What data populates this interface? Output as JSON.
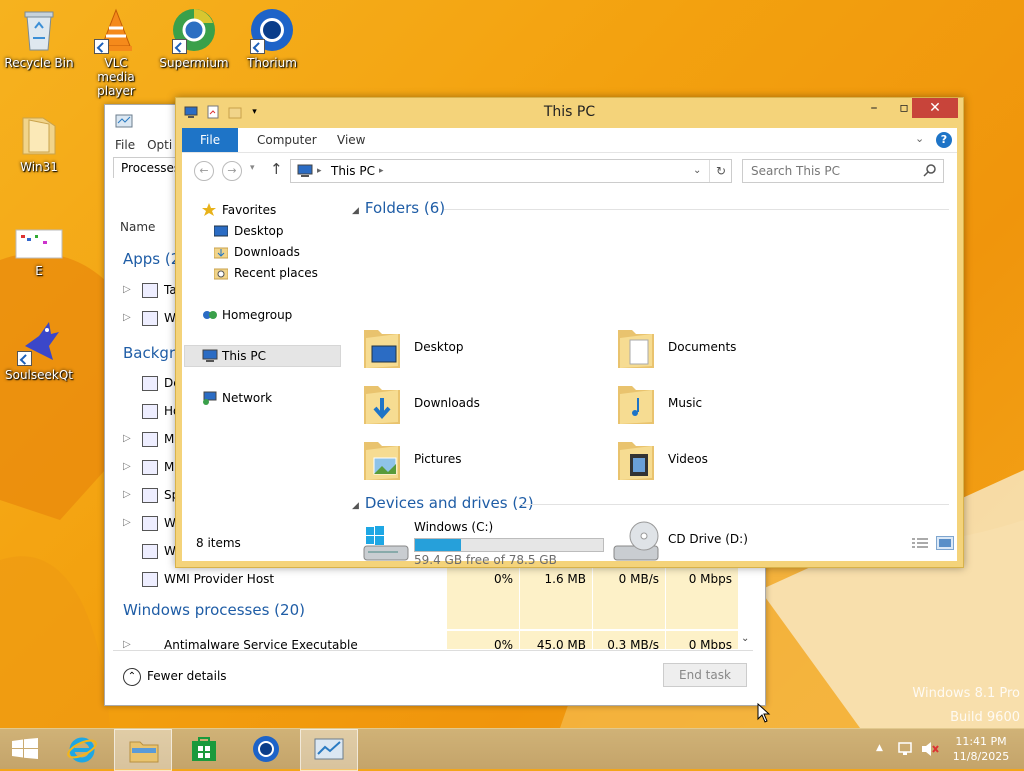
{
  "desktop": {
    "icons": [
      {
        "label": "Recycle Bin",
        "icon": "recycle-bin-icon"
      },
      {
        "label": "VLC media player",
        "icon": "vlc-icon"
      },
      {
        "label": "Supermium",
        "icon": "supermium-icon"
      },
      {
        "label": "Thorium",
        "icon": "thorium-icon"
      },
      {
        "label": "Win31",
        "icon": "folder-icon"
      },
      {
        "label": "E",
        "icon": "image-file-icon"
      },
      {
        "label": "SoulseekQt",
        "icon": "soulseek-icon"
      }
    ],
    "watermark": {
      "line1": "Windows 8.1 Pro",
      "line2": "Build 9600"
    }
  },
  "task_manager": {
    "menu": [
      "File",
      "Opti"
    ],
    "tab": "Processes",
    "column_name": "Name",
    "sections": {
      "apps": "Apps (2",
      "background": "Backgro",
      "windows": "Windows processes (20)"
    },
    "truncated_rows": [
      "Ta",
      "W",
      "De",
      "Ho",
      "Mi",
      "Mi",
      "Sp",
      "W",
      "W"
    ],
    "row_wmi": {
      "name": "WMI Provider Host",
      "cpu": "0%",
      "memory": "1.6 MB",
      "disk": "0 MB/s",
      "network": "0 Mbps"
    },
    "row_antimalware": {
      "name": "Antimalware Service Executable",
      "cpu": "0%",
      "memory": "45.0 MB",
      "disk": "0.3 MB/s",
      "network": "0 Mbps"
    },
    "fewer_details": "Fewer details",
    "end_task": "End task"
  },
  "explorer": {
    "title": "This PC",
    "ribbon_tabs": [
      "File",
      "Computer",
      "View"
    ],
    "address": "This PC",
    "search_placeholder": "Search This PC",
    "nav": {
      "favorites": "Favorites",
      "desktop": "Desktop",
      "downloads": "Downloads",
      "recent": "Recent places",
      "homegroup": "Homegroup",
      "thispc": "This PC",
      "network": "Network"
    },
    "folders_header": "Folders (6)",
    "folders": [
      "Desktop",
      "Documents",
      "Downloads",
      "Music",
      "Pictures",
      "Videos"
    ],
    "devices_header": "Devices and drives (2)",
    "drive_c": {
      "label": "Windows (C:)",
      "free": "59.4 GB free of 78.5 GB",
      "used_fraction": 0.243
    },
    "drive_d": {
      "label": "CD Drive (D:)"
    },
    "status": "8 items"
  },
  "taskbar": {
    "time": "11:41 PM",
    "date": "11/8/2025"
  }
}
